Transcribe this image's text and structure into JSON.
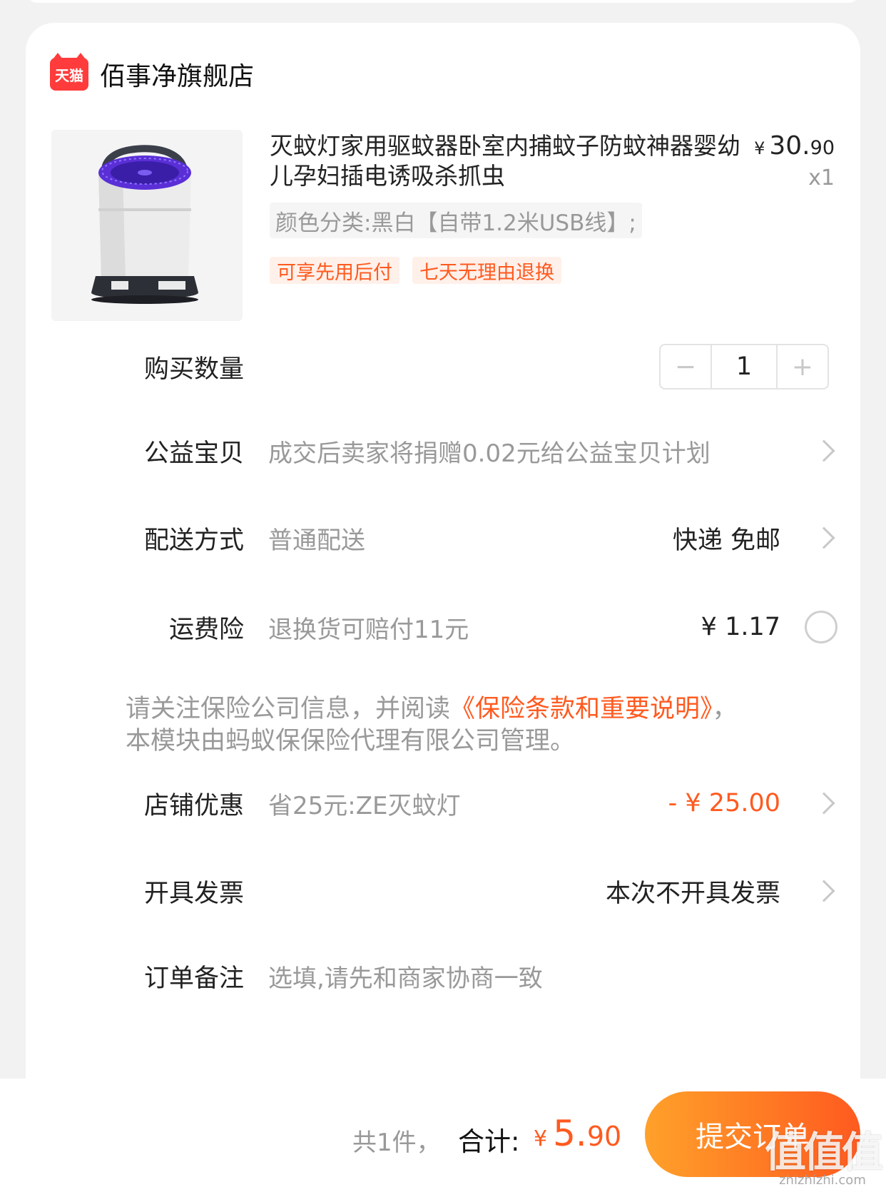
{
  "store": {
    "badge_text": "天猫",
    "name": "佰事净旗舰店"
  },
  "product": {
    "title": "灭蚊灯家用驱蚊器卧室内捕蚊子防蚊神器婴幼儿孕妇插电诱吸杀抓虫",
    "price_symbol": "¥",
    "price_int": "30.",
    "price_dec": "90",
    "quantity_label": "x1",
    "sku": "颜色分类:黑白【自带1.2米USB线】;",
    "tags": [
      "可享先用后付",
      "七天无理由退换"
    ]
  },
  "quantity_row": {
    "label": "购买数量",
    "minus": "−",
    "value": "1",
    "plus": "+"
  },
  "charity_row": {
    "label": "公益宝贝",
    "desc": "成交后卖家将捐赠0.02元给公益宝贝计划"
  },
  "shipping_row": {
    "label": "配送方式",
    "desc": "普通配送",
    "value": "快递 免邮"
  },
  "insurance_row": {
    "label": "运费险",
    "desc": "退换货可赔付11元",
    "value": "¥ 1.17"
  },
  "notice": {
    "prefix": "请关注保险公司信息，并阅读",
    "link": "《保险条款和重要说明》",
    "suffix": "，本模块由蚂蚁保保险代理有限公司管理。"
  },
  "discount_row": {
    "label": "店铺优惠",
    "desc": "省25元:ZE灭蚊灯",
    "value": "- ¥ 25.00"
  },
  "invoice_row": {
    "label": "开具发票",
    "value": "本次不开具发票"
  },
  "remark_row": {
    "label": "订单备注",
    "placeholder": "选填,请先和商家协商一致"
  },
  "footer": {
    "count": "共1件，",
    "total_label": "合计:",
    "total_symbol": "¥",
    "total_int": "5.",
    "total_dec": "90",
    "submit": "提交订单"
  },
  "watermark": {
    "big": "值值值",
    "small": "zhizhizhi.com"
  },
  "colors": {
    "accent": "#ff5a1f",
    "button_gradient_start": "#ffa12a",
    "tmall_red": "#ff3b3b"
  }
}
